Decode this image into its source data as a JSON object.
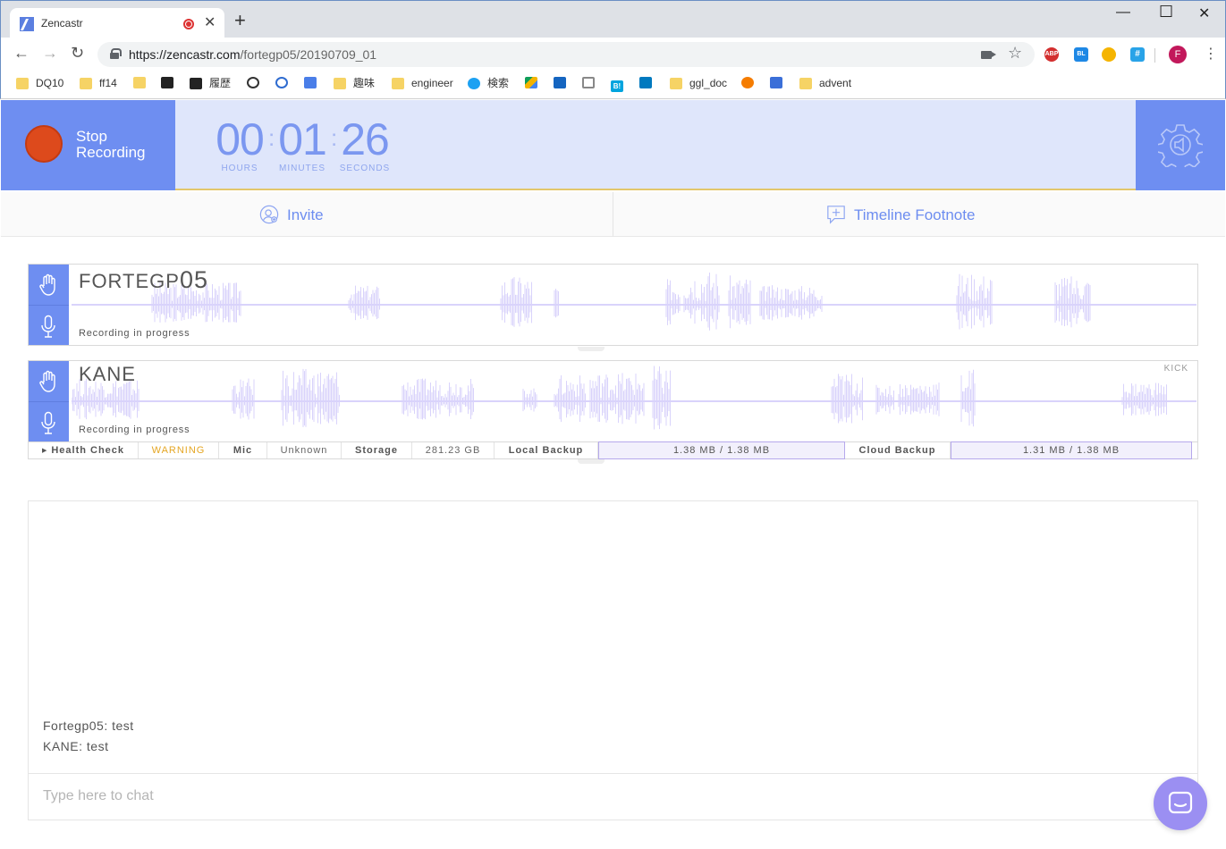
{
  "browser": {
    "tab_title": "Zencastr",
    "url_host": "https://zencastr.com",
    "url_path": "/fortegp05/20190709_01",
    "profile_initial": "F",
    "bookmarks": [
      "DQ10",
      "ff14",
      "",
      "",
      "履歴",
      "",
      "",
      "",
      "趣味",
      "engineer",
      "検索",
      "",
      "",
      "",
      "",
      "",
      "ggl_doc",
      "",
      "",
      "advent"
    ],
    "extensions": {
      "abp": "ABP",
      "bl": "BL",
      "hash": "#",
      "b_hatena": "B!"
    }
  },
  "recorder": {
    "stop_label": "Stop Recording",
    "hours": "00",
    "minutes": "01",
    "seconds": "26",
    "hours_label": "HOURS",
    "minutes_label": "MINUTES",
    "seconds_label": "SECONDS"
  },
  "actions": {
    "invite": "Invite",
    "footnote": "Timeline Footnote"
  },
  "tracks": [
    {
      "name_main": "FORTEGP",
      "name_suffix": "05",
      "status": "Recording in progress"
    },
    {
      "name_main": "KANE",
      "name_suffix": "",
      "status": "Recording in progress",
      "kick": "KICK"
    }
  ],
  "health": {
    "health_check": "Health Check",
    "warning": "WARNING",
    "mic_label": "Mic",
    "mic_value": "Unknown",
    "storage_label": "Storage",
    "storage_value": "281.23 GB",
    "local_label": "Local Backup",
    "local_value": "1.38 MB / 1.38 MB",
    "cloud_label": "Cloud Backup",
    "cloud_value": "1.31 MB / 1.38 MB"
  },
  "chat": {
    "messages": [
      "Fortegp05: test",
      "KANE: test"
    ],
    "placeholder": "Type here to chat"
  },
  "colors": {
    "accent": "#6e8ef1",
    "bar_bg": "#dfe6fb",
    "record_red": "#dd4a1c",
    "wave": "#d9d3fb",
    "warning": "#e5a623"
  }
}
